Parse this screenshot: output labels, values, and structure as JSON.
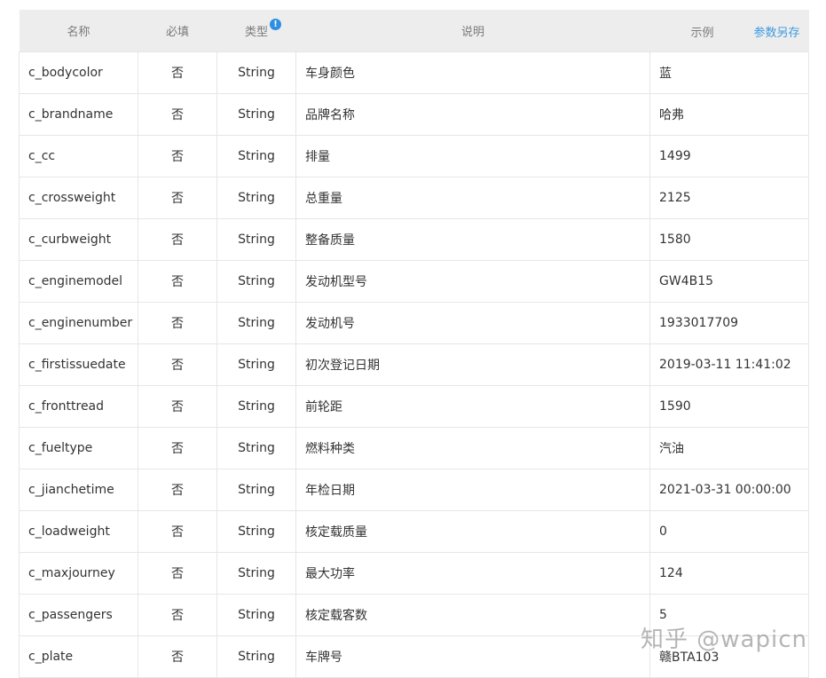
{
  "header": {
    "name": "名称",
    "required": "必填",
    "type": "类型",
    "description": "说明",
    "example": "示例",
    "save_as": "参数另存"
  },
  "rows": [
    {
      "name": "c_bodycolor",
      "required": "否",
      "type": "String",
      "description": "车身颜色",
      "example": "蓝"
    },
    {
      "name": "c_brandname",
      "required": "否",
      "type": "String",
      "description": "品牌名称",
      "example": "哈弗"
    },
    {
      "name": "c_cc",
      "required": "否",
      "type": "String",
      "description": "排量",
      "example": "1499"
    },
    {
      "name": "c_crossweight",
      "required": "否",
      "type": "String",
      "description": "总重量",
      "example": "2125"
    },
    {
      "name": "c_curbweight",
      "required": "否",
      "type": "String",
      "description": "整备质量",
      "example": "1580"
    },
    {
      "name": "c_enginemodel",
      "required": "否",
      "type": "String",
      "description": "发动机型号",
      "example": "GW4B15"
    },
    {
      "name": "c_enginenumber",
      "required": "否",
      "type": "String",
      "description": "发动机号",
      "example": "1933017709"
    },
    {
      "name": "c_firstissuedate",
      "required": "否",
      "type": "String",
      "description": "初次登记日期",
      "example": "2019-03-11 11:41:02"
    },
    {
      "name": "c_fronttread",
      "required": "否",
      "type": "String",
      "description": "前轮距",
      "example": "1590"
    },
    {
      "name": "c_fueltype",
      "required": "否",
      "type": "String",
      "description": "燃料种类",
      "example": "汽油"
    },
    {
      "name": "c_jianchetime",
      "required": "否",
      "type": "String",
      "description": "年检日期",
      "example": "2021-03-31 00:00:00"
    },
    {
      "name": "c_loadweight",
      "required": "否",
      "type": "String",
      "description": "核定载质量",
      "example": "0"
    },
    {
      "name": "c_maxjourney",
      "required": "否",
      "type": "String",
      "description": "最大功率",
      "example": "124"
    },
    {
      "name": "c_passengers",
      "required": "否",
      "type": "String",
      "description": "核定载客数",
      "example": "5"
    },
    {
      "name": "c_plate",
      "required": "否",
      "type": "String",
      "description": "车牌号",
      "example": "赣BTA103"
    }
  ],
  "watermark": "知乎 @wapicn",
  "colors": {
    "header_bg": "#ededed",
    "link": "#3d9ae0",
    "info_icon": "#2f8fe0",
    "border": "#e6e6e6"
  },
  "icons": {
    "info": "info-icon"
  }
}
